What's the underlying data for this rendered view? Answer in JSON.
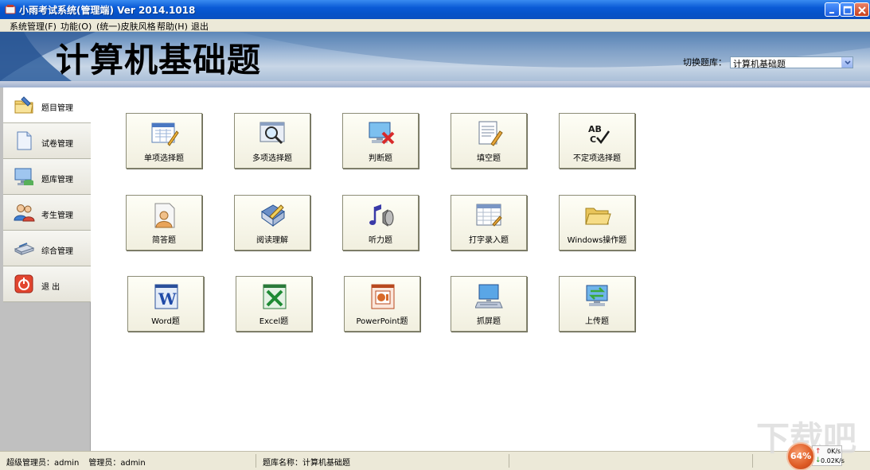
{
  "window": {
    "title": "小雨考试系统(管理端) Ver 2014.1018"
  },
  "menu": [
    {
      "label": "系统管理(F)"
    },
    {
      "label": "功能(O)"
    },
    {
      "label": "(统一)皮肤风格"
    },
    {
      "label": "帮助(H)"
    },
    {
      "label": "退出"
    }
  ],
  "banner": {
    "title": "计算机基础题",
    "switch_label": "切换题库：",
    "switch_value": "计算机基础题"
  },
  "sidebar": {
    "items": [
      {
        "label": "题目管理",
        "icon": "folder-pen-icon",
        "active": true
      },
      {
        "label": "试卷管理",
        "icon": "document-icon",
        "active": false
      },
      {
        "label": "题库管理",
        "icon": "monitor-database-icon",
        "active": false
      },
      {
        "label": "考生管理",
        "icon": "users-icon",
        "active": false
      },
      {
        "label": "综合管理",
        "icon": "scanner-icon",
        "active": false
      },
      {
        "label": "退  出",
        "icon": "power-icon",
        "active": false
      }
    ]
  },
  "tiles": [
    {
      "label": "单项选择题",
      "icon": "form-pencil-icon"
    },
    {
      "label": "多项选择题",
      "icon": "magnifier-window-icon"
    },
    {
      "label": "判断题",
      "icon": "monitor-x-icon"
    },
    {
      "label": "填空题",
      "icon": "notepad-pencil-icon"
    },
    {
      "label": "不定项选择题",
      "icon": "spellcheck-icon"
    },
    {
      "label": "简答题",
      "icon": "person-document-icon"
    },
    {
      "label": "阅读理解",
      "icon": "book-pen-icon"
    },
    {
      "label": "听力题",
      "icon": "speaker-music-icon"
    },
    {
      "label": "打字录入题",
      "icon": "spreadsheet-window-icon"
    },
    {
      "label": "Windows操作题",
      "icon": "open-folder-icon"
    },
    {
      "label": "Word题",
      "icon": "word-icon"
    },
    {
      "label": "Excel题",
      "icon": "excel-icon"
    },
    {
      "label": "PowerPoint题",
      "icon": "powerpoint-icon"
    },
    {
      "label": "抓屏题",
      "icon": "monitor-keyboard-icon"
    },
    {
      "label": "上传题",
      "icon": "monitor-sync-icon"
    }
  ],
  "status": {
    "super_admin_label": "超级管理员：",
    "super_admin_value": "admin",
    "admin_label": "管理员：",
    "admin_value": "admin",
    "bank_label": "题库名称：",
    "bank_value": "计算机基础题"
  },
  "net": {
    "percent": "64%",
    "up": "0K/s",
    "down": "0.02K/s"
  },
  "colors": {
    "titlebar": "#0a5ad6",
    "menubar": "#ece9d8",
    "sidebar": "#c0c0c0",
    "tile_border": "#8c8c76"
  }
}
